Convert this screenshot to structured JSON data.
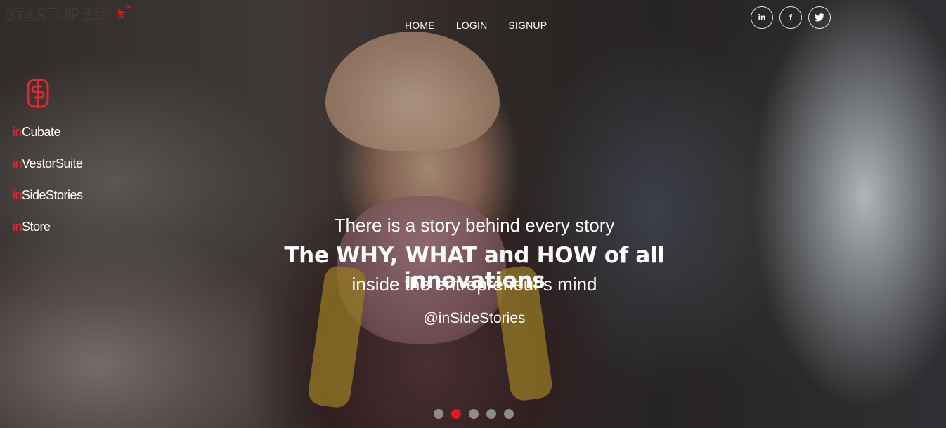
{
  "brand": {
    "name": "STARTUPBAY",
    "suffix": ".in",
    "tm": "TM"
  },
  "nav": {
    "items": [
      "HOME",
      "LOGIN",
      "SIGNUP"
    ]
  },
  "social": [
    {
      "icon": "linkedin-icon",
      "glyph": "in"
    },
    {
      "icon": "facebook-icon",
      "glyph": "f"
    },
    {
      "icon": "twitter-icon",
      "glyph": "t"
    }
  ],
  "sidemenu": {
    "items": [
      {
        "prefix": "in",
        "label": "Cubate"
      },
      {
        "prefix": "in",
        "label": "VestorSuite"
      },
      {
        "prefix": "in",
        "label": "SideStories"
      },
      {
        "prefix": "in",
        "label": "Store"
      }
    ]
  },
  "hero": {
    "line1": "There is a story behind every story",
    "line2": "The WHY, WHAT and HOW of all innovations",
    "line3": "inside the entrepreneur's mind",
    "handle": "@inSideStories"
  },
  "carousel": {
    "total_slides": 5,
    "active_index": 1
  },
  "colors": {
    "accent": "#e0282d",
    "dot_active": "#e8161c",
    "dot_inactive": "#8c8c8c"
  }
}
